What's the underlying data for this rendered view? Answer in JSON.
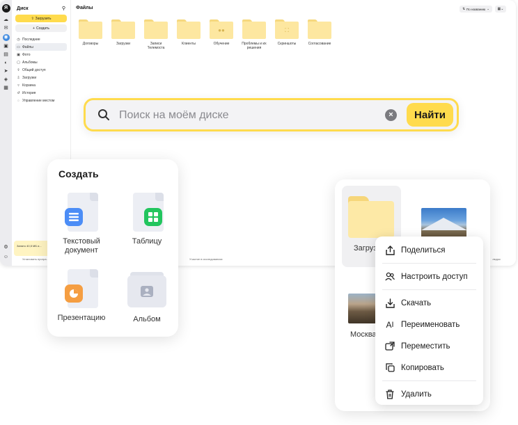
{
  "app": {
    "service_name": "Диск",
    "logo_letter": "Я",
    "upload_label": "Загрузить",
    "create_label": "Создать",
    "sidebar_items": [
      {
        "label": "Последние",
        "icon": "clock-icon"
      },
      {
        "label": "Файлы",
        "icon": "folder-icon",
        "selected": true
      },
      {
        "label": "Фото",
        "icon": "photo-icon"
      },
      {
        "label": "Альбомы",
        "icon": "album-icon"
      },
      {
        "label": "Общий доступ",
        "icon": "share-icon"
      },
      {
        "label": "Загрузки",
        "icon": "download-icon"
      },
      {
        "label": "Корзина",
        "icon": "trash-icon"
      },
      {
        "label": "История",
        "icon": "history-icon"
      },
      {
        "label": "Управление местом",
        "icon": "storage-icon"
      }
    ],
    "promo_text": "Занято 40,5 МБ и...",
    "main_title": "Файлы",
    "sort_label": "По названию",
    "folders": [
      {
        "name": "Договоры",
        "emblem": ""
      },
      {
        "name": "Загрузки",
        "emblem": ""
      },
      {
        "name": "Записи Телемоста",
        "emblem": ""
      },
      {
        "name": "Клиенты",
        "emblem": ""
      },
      {
        "name": "Обучение",
        "emblem": "👥"
      },
      {
        "name": "Проблемы и их решения",
        "emblem": ""
      },
      {
        "name": "Скриншоты",
        "emblem": "⛶"
      },
      {
        "name": "Согласование",
        "emblem": ""
      }
    ],
    "footer_left": "Установить програ...",
    "footer_mid": "Участие в исследованиях",
    "footer_right": "людос"
  },
  "search": {
    "placeholder": "Поиск на моём диске",
    "button_label": "Найти"
  },
  "create_panel": {
    "title": "Создать",
    "items": [
      {
        "label": "Текстовый документ",
        "icon": "text-document-icon",
        "color": "#4c8df6"
      },
      {
        "label": "Таблицу",
        "icon": "spreadsheet-icon",
        "color": "#22c55e"
      },
      {
        "label": "Презентацию",
        "icon": "presentation-icon",
        "color": "#f59e42"
      },
      {
        "label": "Альбом",
        "icon": "album-icon",
        "color": "#aab0c0"
      }
    ]
  },
  "files_panel": {
    "folder_label": "Загрузки",
    "city_label": "Москва"
  },
  "context_menu": {
    "items": [
      {
        "label": "Поделиться",
        "icon": "share-icon"
      },
      {
        "label": "Настроить доступ",
        "icon": "users-icon"
      },
      {
        "label": "Скачать",
        "icon": "download-icon"
      },
      {
        "label": "Переименовать",
        "icon": "rename-icon"
      },
      {
        "label": "Переместить",
        "icon": "move-icon"
      },
      {
        "label": "Копировать",
        "icon": "copy-icon"
      },
      {
        "label": "Удалить",
        "icon": "trash-icon"
      }
    ]
  },
  "colors": {
    "accent": "#ffdb4d",
    "panel_bg": "#ffffff",
    "app_bg": "#f4f4f6"
  }
}
